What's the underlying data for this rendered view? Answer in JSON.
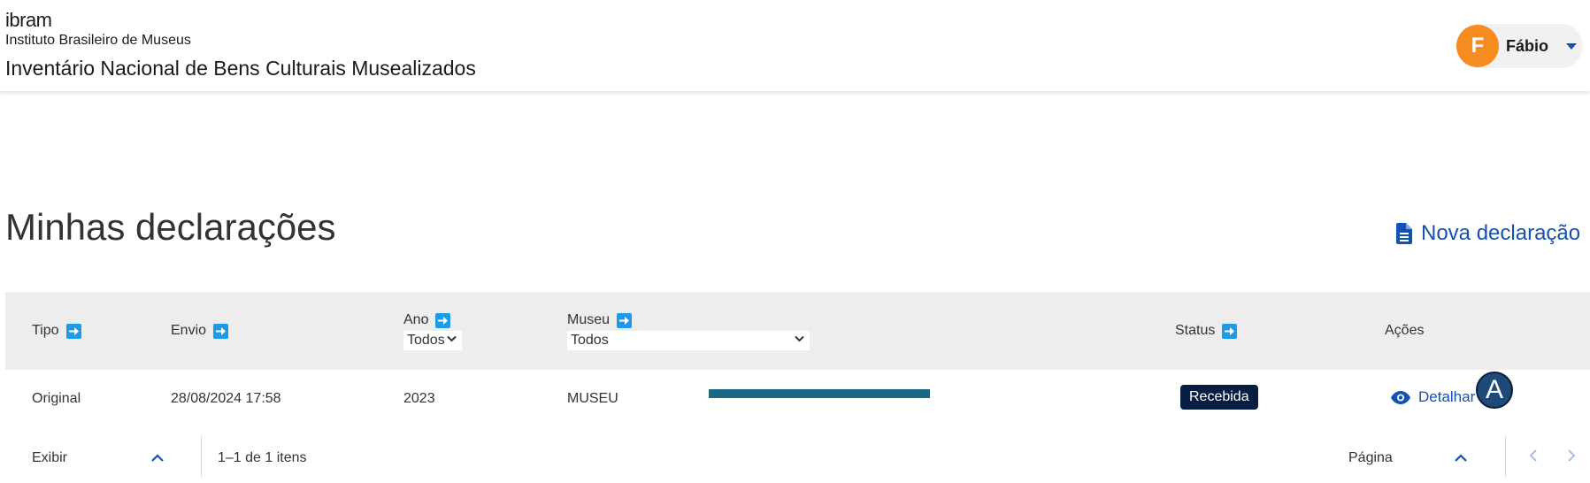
{
  "header": {
    "logo_text": "ibram",
    "institution": "Instituto Brasileiro de Museus",
    "app_title": "Inventário Nacional de Bens Culturais Musealizados",
    "user": {
      "initial": "F",
      "name": "Fábio"
    }
  },
  "page": {
    "title": "Minhas declarações",
    "new_declaration_label": "Nova declaração"
  },
  "table": {
    "columns": {
      "tipo": "Tipo",
      "envio": "Envio",
      "ano": "Ano",
      "museu": "Museu",
      "status": "Status",
      "acoes": "Ações"
    },
    "filters": {
      "ano": "Todos",
      "museu": "Todos"
    },
    "rows": [
      {
        "tipo": "Original",
        "envio": "28/08/2024 17:58",
        "ano": "2023",
        "museu": "MUSEU",
        "status": "Recebida",
        "action": "Detalhar"
      }
    ]
  },
  "annotation": {
    "marker": "A"
  },
  "pagination": {
    "show_label": "Exibir",
    "range_text": "1–1 de 1 itens",
    "page_label": "Página"
  },
  "colors": {
    "accent": "#1351b4",
    "sort_icon": "#1e9be8",
    "avatar": "#f68b1f",
    "badge": "#071d41",
    "header_row": "#ededed",
    "redaction": "#1a6883"
  }
}
